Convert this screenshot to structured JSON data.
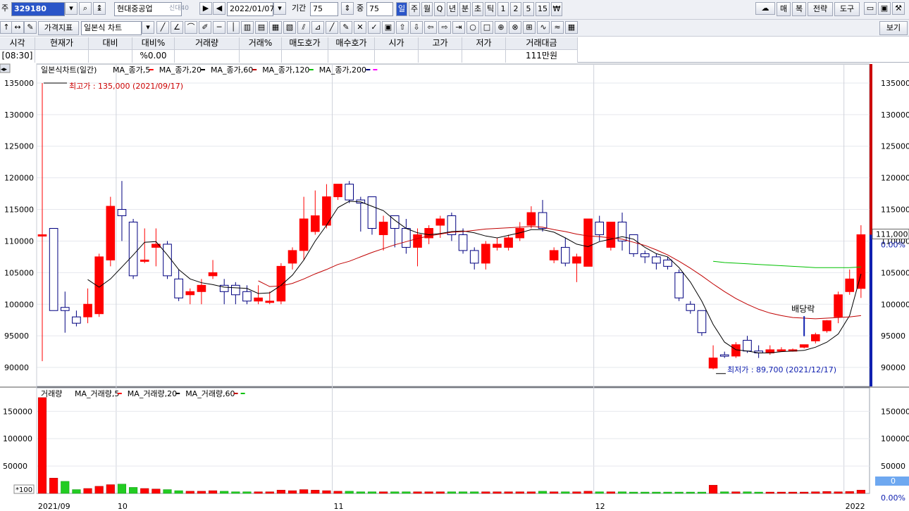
{
  "toolbar": {
    "code_prefix": "주",
    "stock_code": "329180",
    "stock_name": "현대중공업",
    "credit_badge": "신대40",
    "date": "2022/01/07",
    "period_label": "기간",
    "period_value": "75",
    "count_label": "중",
    "count_value": "75",
    "intervals": [
      "일",
      "주",
      "월",
      "Q",
      "년",
      "분",
      "초",
      "틱",
      "1",
      "2",
      "5",
      "15",
      "₩"
    ],
    "active_interval": "일",
    "right_buttons": [
      "매",
      "복",
      "전략",
      "도구"
    ],
    "price_indicator_label": "가격지표",
    "chart_type": "일본식 차트",
    "view_button": "보기"
  },
  "quote": {
    "headers": [
      "시각",
      "현재가",
      "대비",
      "대비%",
      "거래량",
      "거래%",
      "매도호가",
      "매수호가",
      "시가",
      "고가",
      "저가",
      "거래대금"
    ],
    "values": [
      "[08:30]",
      "",
      "",
      "%0.00",
      "",
      "",
      "",
      "",
      "",
      "",
      "",
      "111만원"
    ]
  },
  "colors": {
    "up": "#ff0000",
    "down_fill": "#ffffff",
    "down_line": "#000080",
    "ma5": "#000000",
    "ma20": "#c00000",
    "ma60": "#00c000",
    "ma120": "#000080",
    "ma200": "#ff00ff"
  },
  "chart_data": {
    "type": "candlestick",
    "title": "일본식차트(일간)",
    "legend": [
      {
        "name": "MA_종가,5",
        "color": "#ff0000"
      },
      {
        "name": "MA_종가,20",
        "color": "#000000"
      },
      {
        "name": "MA_종가,60",
        "color": "#c00000"
      },
      {
        "name": "MA_종가,120",
        "color": "#00c000"
      },
      {
        "name": "MA_종가,200",
        "color": "#000080"
      },
      {
        "name": "",
        "color": "#ff00ff"
      }
    ],
    "ylim": [
      87000,
      138000
    ],
    "yticks": [
      90000,
      95000,
      100000,
      105000,
      110000,
      115000,
      120000,
      125000,
      130000,
      135000
    ],
    "ytick_labels": [
      "90000",
      "95000",
      "100000",
      "105000",
      "110000",
      "115000",
      "120000",
      "125000",
      "130000",
      "135000"
    ],
    "last_price_label": "111,000",
    "last_change_label": "0.00%",
    "annotations": {
      "high": "최고가 : 135,000 (2021/09/17)",
      "low": "최저가 : 89,700 (2021/12/17)",
      "dividend": "배당락"
    },
    "x_labels": [
      {
        "index": 0,
        "label": "2021/09"
      },
      {
        "index": 7,
        "label": "10"
      },
      {
        "index": 26,
        "label": "11"
      },
      {
        "index": 49,
        "label": "12"
      },
      {
        "index": 71,
        "label": "2022"
      }
    ],
    "candles": [
      {
        "o": 111000,
        "c": 111000,
        "h": 135000,
        "l": 91000
      },
      {
        "o": 112000,
        "c": 99000,
        "h": 112000,
        "l": 99000
      },
      {
        "o": 99500,
        "c": 99000,
        "h": 102000,
        "l": 95500
      },
      {
        "o": 98000,
        "c": 97000,
        "h": 99000,
        "l": 96500
      },
      {
        "o": 98000,
        "c": 100000,
        "h": 102500,
        "l": 97000
      },
      {
        "o": 98500,
        "c": 107500,
        "h": 108000,
        "l": 98000
      },
      {
        "o": 107000,
        "c": 115500,
        "h": 117000,
        "l": 106000
      },
      {
        "o": 115000,
        "c": 114000,
        "h": 119500,
        "l": 110000
      },
      {
        "o": 113000,
        "c": 104500,
        "h": 113500,
        "l": 104000
      },
      {
        "o": 107000,
        "c": 107000,
        "h": 112000,
        "l": 106500
      },
      {
        "o": 109000,
        "c": 109500,
        "h": 112000,
        "l": 106000
      },
      {
        "o": 109500,
        "c": 104500,
        "h": 110000,
        "l": 104000
      },
      {
        "o": 104000,
        "c": 101000,
        "h": 105500,
        "l": 100500
      },
      {
        "o": 101500,
        "c": 102000,
        "h": 102500,
        "l": 100000
      },
      {
        "o": 102000,
        "c": 103000,
        "h": 104000,
        "l": 100000
      },
      {
        "o": 104500,
        "c": 105000,
        "h": 107000,
        "l": 104000
      },
      {
        "o": 103000,
        "c": 102000,
        "h": 104000,
        "l": 100000
      },
      {
        "o": 103000,
        "c": 101500,
        "h": 103500,
        "l": 100000
      },
      {
        "o": 102000,
        "c": 100500,
        "h": 103000,
        "l": 100000
      },
      {
        "o": 100500,
        "c": 101000,
        "h": 103000,
        "l": 100000
      },
      {
        "o": 100500,
        "c": 100500,
        "h": 102000,
        "l": 100000
      },
      {
        "o": 100500,
        "c": 106000,
        "h": 106500,
        "l": 100000
      },
      {
        "o": 106500,
        "c": 108500,
        "h": 109000,
        "l": 105500
      },
      {
        "o": 108500,
        "c": 113500,
        "h": 117000,
        "l": 107000
      },
      {
        "o": 111500,
        "c": 114000,
        "h": 118000,
        "l": 111000
      },
      {
        "o": 112500,
        "c": 117000,
        "h": 119000,
        "l": 112000
      },
      {
        "o": 117000,
        "c": 119000,
        "h": 119000,
        "l": 116500
      },
      {
        "o": 119000,
        "c": 116500,
        "h": 119500,
        "l": 116000
      },
      {
        "o": 116500,
        "c": 116000,
        "h": 117000,
        "l": 111500
      },
      {
        "o": 117000,
        "c": 112000,
        "h": 117000,
        "l": 111000
      },
      {
        "o": 111000,
        "c": 113000,
        "h": 114000,
        "l": 108500
      },
      {
        "o": 114000,
        "c": 112000,
        "h": 114000,
        "l": 109000
      },
      {
        "o": 112000,
        "c": 109000,
        "h": 113500,
        "l": 108000
      },
      {
        "o": 109000,
        "c": 111000,
        "h": 112000,
        "l": 106000
      },
      {
        "o": 110500,
        "c": 112000,
        "h": 112500,
        "l": 109500
      },
      {
        "o": 112500,
        "c": 113500,
        "h": 114000,
        "l": 110500
      },
      {
        "o": 114000,
        "c": 111000,
        "h": 114500,
        "l": 110000
      },
      {
        "o": 111000,
        "c": 108500,
        "h": 112000,
        "l": 108000
      },
      {
        "o": 108500,
        "c": 106500,
        "h": 109000,
        "l": 105500
      },
      {
        "o": 106500,
        "c": 109500,
        "h": 110000,
        "l": 105500
      },
      {
        "o": 109000,
        "c": 109500,
        "h": 110500,
        "l": 108500
      },
      {
        "o": 109000,
        "c": 110500,
        "h": 111000,
        "l": 108500
      },
      {
        "o": 110500,
        "c": 112000,
        "h": 113000,
        "l": 110000
      },
      {
        "o": 112500,
        "c": 114500,
        "h": 115500,
        "l": 112000
      },
      {
        "o": 114500,
        "c": 112000,
        "h": 116500,
        "l": 111500
      },
      {
        "o": 107000,
        "c": 108500,
        "h": 109000,
        "l": 106500
      },
      {
        "o": 109000,
        "c": 106500,
        "h": 110500,
        "l": 106000
      },
      {
        "o": 106500,
        "c": 107500,
        "h": 108000,
        "l": 103500
      },
      {
        "o": 106000,
        "c": 113500,
        "h": 113500,
        "l": 106000
      },
      {
        "o": 113000,
        "c": 111000,
        "h": 114000,
        "l": 110000
      },
      {
        "o": 109000,
        "c": 113000,
        "h": 113000,
        "l": 108500
      },
      {
        "o": 113000,
        "c": 110000,
        "h": 114500,
        "l": 108500
      },
      {
        "o": 111000,
        "c": 108000,
        "h": 111000,
        "l": 107500
      },
      {
        "o": 108000,
        "c": 107500,
        "h": 108500,
        "l": 106500
      },
      {
        "o": 107500,
        "c": 106500,
        "h": 108000,
        "l": 105500
      },
      {
        "o": 107000,
        "c": 106000,
        "h": 107500,
        "l": 105500
      },
      {
        "o": 105000,
        "c": 101000,
        "h": 105500,
        "l": 100500
      },
      {
        "o": 100000,
        "c": 99000,
        "h": 100500,
        "l": 98500
      },
      {
        "o": 99000,
        "c": 95500,
        "h": 99000,
        "l": 95000
      },
      {
        "o": 89900,
        "c": 91500,
        "h": 93500,
        "l": 89700
      },
      {
        "o": 92000,
        "c": 91800,
        "h": 92500,
        "l": 91500
      },
      {
        "o": 91800,
        "c": 93600,
        "h": 94000,
        "l": 91500
      },
      {
        "o": 94300,
        "c": 92600,
        "h": 95000,
        "l": 92300
      },
      {
        "o": 92600,
        "c": 92300,
        "h": 93500,
        "l": 91500
      },
      {
        "o": 92300,
        "c": 92800,
        "h": 93500,
        "l": 92000
      },
      {
        "o": 92800,
        "c": 92800,
        "h": 93200,
        "l": 92500
      },
      {
        "o": 92800,
        "c": 92800,
        "h": 93000,
        "l": 92500
      },
      {
        "o": 93200,
        "c": 93600,
        "h": 93600,
        "l": 93000
      },
      {
        "o": 94200,
        "c": 95200,
        "h": 95500,
        "l": 93800
      },
      {
        "o": 95800,
        "c": 97400,
        "h": 97500,
        "l": 95500
      },
      {
        "o": 98000,
        "c": 101500,
        "h": 102000,
        "l": 97000
      },
      {
        "o": 102000,
        "c": 104000,
        "h": 105500,
        "l": 101500
      },
      {
        "o": 102500,
        "c": 111000,
        "h": 112500,
        "l": 101000
      }
    ],
    "ma5": [
      null,
      null,
      null,
      null,
      103900,
      102700,
      104000,
      105900,
      107800,
      109800,
      109900,
      107800,
      105500,
      104000,
      103400,
      103100,
      102700,
      102600,
      102500,
      101700,
      101800,
      103000,
      104600,
      107000,
      110000,
      112500,
      115300,
      116300,
      116200,
      115500,
      114800,
      113300,
      112000,
      111300,
      111000,
      111200,
      111500,
      111600,
      111300,
      110800,
      110500,
      110900,
      111300,
      111800,
      111800,
      111400,
      110500,
      109500,
      109100,
      109900,
      110300,
      110700,
      110300,
      109000,
      108000,
      107500,
      105800,
      103500,
      100500,
      96800,
      94000,
      92800,
      92600,
      92300,
      92300,
      92500,
      92600,
      92700,
      93200,
      94000,
      95300,
      98200,
      104800
    ],
    "ma20": [
      null,
      null,
      null,
      null,
      null,
      null,
      null,
      null,
      null,
      null,
      null,
      null,
      null,
      null,
      null,
      null,
      null,
      null,
      null,
      103700,
      102800,
      102900,
      103300,
      104000,
      104800,
      105500,
      106300,
      106800,
      107500,
      108200,
      108800,
      109400,
      109900,
      110400,
      110800,
      111100,
      111400,
      111500,
      111700,
      111900,
      112000,
      112100,
      112200,
      112300,
      112200,
      111800,
      111500,
      111100,
      110800,
      110700,
      110500,
      110300,
      109800,
      109300,
      108600,
      107800,
      106800,
      105700,
      104500,
      103200,
      102000,
      100900,
      100000,
      99200,
      98600,
      98200,
      97900,
      97800,
      97700,
      97800,
      97900,
      98000,
      98200
    ],
    "ma60": [
      null,
      null,
      null,
      null,
      null,
      null,
      null,
      null,
      null,
      null,
      null,
      null,
      null,
      null,
      null,
      null,
      null,
      null,
      null,
      null,
      null,
      null,
      null,
      null,
      null,
      null,
      null,
      null,
      null,
      null,
      null,
      null,
      null,
      null,
      null,
      null,
      null,
      null,
      null,
      null,
      null,
      null,
      null,
      null,
      null,
      null,
      null,
      null,
      null,
      null,
      null,
      null,
      null,
      null,
      null,
      null,
      null,
      null,
      null,
      106800,
      106600,
      106500,
      106400,
      106300,
      106200,
      106100,
      106000,
      105900,
      105800,
      105800,
      105800,
      105800,
      105900
    ],
    "volume": {
      "ylim": [
        0,
        180000
      ],
      "yticks": [
        50000,
        100000,
        150000
      ],
      "ytick_labels": [
        "50000",
        "100000",
        "150000"
      ],
      "multiplier_label": "*100",
      "title": "거래량",
      "legend": [
        {
          "name": "MA_거래량,5",
          "color": "#ff0000"
        },
        {
          "name": "MA_거래량,20",
          "color": "#000000"
        },
        {
          "name": "MA_거래량,60",
          "color": "#c00000"
        },
        {
          "name": "",
          "color": "#00c000"
        }
      ],
      "last_value_label": "0",
      "last_change_label": "0.00%",
      "values": [
        175000,
        28000,
        22000,
        7000,
        9000,
        13000,
        16000,
        17000,
        11000,
        9000,
        8000,
        7000,
        5000,
        4000,
        4000,
        5000,
        4000,
        3000,
        3000,
        3000,
        3000,
        6000,
        5000,
        7000,
        6000,
        5000,
        4000,
        4000,
        3000,
        3000,
        3000,
        3000,
        3000,
        3000,
        3000,
        3000,
        3000,
        3000,
        3000,
        3000,
        3000,
        3000,
        3000,
        3000,
        4000,
        3000,
        3000,
        3000,
        4000,
        3000,
        3000,
        3000,
        2500,
        2500,
        2500,
        2500,
        2500,
        2500,
        2500,
        15000,
        3000,
        3000,
        3000,
        2500,
        2500,
        2500,
        2500,
        2500,
        3000,
        3500,
        3000,
        3500,
        6000
      ],
      "up_flags": [
        1,
        1,
        0,
        0,
        1,
        1,
        1,
        0,
        0,
        1,
        1,
        0,
        0,
        1,
        1,
        1,
        0,
        0,
        0,
        1,
        1,
        1,
        1,
        1,
        1,
        1,
        1,
        0,
        0,
        0,
        1,
        0,
        0,
        1,
        1,
        1,
        0,
        0,
        0,
        1,
        1,
        1,
        1,
        1,
        0,
        1,
        0,
        1,
        1,
        0,
        1,
        0,
        0,
        0,
        0,
        0,
        0,
        0,
        0,
        1,
        0,
        1,
        0,
        0,
        1,
        1,
        1,
        1,
        1,
        1,
        1,
        1,
        1
      ]
    }
  }
}
